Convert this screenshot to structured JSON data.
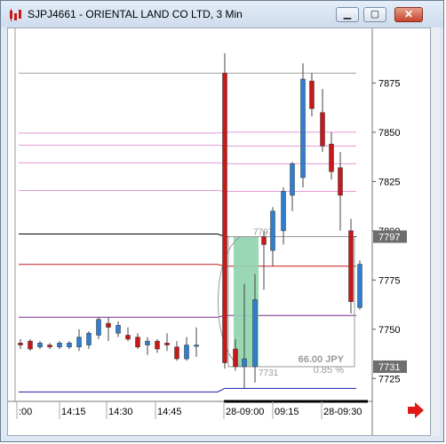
{
  "window": {
    "title": "SJPJ4661 - ORIENTAL LAND CO LTD, 3 Min",
    "min_glyph": "▁",
    "max_glyph": "▢",
    "close_glyph": "✕"
  },
  "chart_data": {
    "type": "candlestick",
    "instrument": "SJPJ4661",
    "x_labels": [
      ":00",
      "14:15",
      "14:30",
      "14:45",
      "28-09:00",
      "09:15",
      "28-09:30"
    ],
    "y_ticks": [
      7875,
      7850,
      7825,
      7800,
      7775,
      7750,
      7725
    ],
    "ylim": [
      7717,
      7900
    ],
    "price_labels": [
      {
        "value": 7797,
        "text": "7797"
      },
      {
        "value": 7731,
        "text": "7731"
      }
    ],
    "grid": false,
    "candles": [
      {
        "o": 7743,
        "h": 7745,
        "l": 7740,
        "c": 7742
      },
      {
        "o": 7744,
        "h": 7745,
        "l": 7739,
        "c": 7740
      },
      {
        "o": 7741,
        "h": 7744,
        "l": 7740,
        "c": 7743
      },
      {
        "o": 7742,
        "h": 7743,
        "l": 7740,
        "c": 7741
      },
      {
        "o": 7741,
        "h": 7744,
        "l": 7740,
        "c": 7743
      },
      {
        "o": 7741,
        "h": 7744,
        "l": 7740,
        "c": 7743
      },
      {
        "o": 7741,
        "h": 7750,
        "l": 7739,
        "c": 7746
      },
      {
        "o": 7742,
        "h": 7749,
        "l": 7740,
        "c": 7748
      },
      {
        "o": 7747,
        "h": 7756,
        "l": 7745,
        "c": 7755
      },
      {
        "o": 7753,
        "h": 7756,
        "l": 7744,
        "c": 7751
      },
      {
        "o": 7748,
        "h": 7754,
        "l": 7746,
        "c": 7752
      },
      {
        "o": 7747,
        "h": 7751,
        "l": 7744,
        "c": 7745
      },
      {
        "o": 7746,
        "h": 7748,
        "l": 7740,
        "c": 7741
      },
      {
        "o": 7742,
        "h": 7746,
        "l": 7737,
        "c": 7744
      },
      {
        "o": 7744,
        "h": 7745,
        "l": 7738,
        "c": 7740
      },
      {
        "o": 7743,
        "h": 7748,
        "l": 7739,
        "c": 7742
      },
      {
        "o": 7741,
        "h": 7744,
        "l": 7734,
        "c": 7735
      },
      {
        "o": 7735,
        "h": 7746,
        "l": 7734,
        "c": 7742
      },
      {
        "o": 7742,
        "h": 7751,
        "l": 7736,
        "c": 7742
      },
      {
        "o": 7880,
        "h": 7890,
        "l": 7730,
        "c": 7733
      },
      {
        "o": 7740,
        "h": 7745,
        "l": 7729,
        "c": 7731
      },
      {
        "o": 7731,
        "h": 7773,
        "l": 7720,
        "c": 7735
      },
      {
        "o": 7731,
        "h": 7778,
        "l": 7723,
        "c": 7765
      },
      {
        "o": 7797,
        "h": 7800,
        "l": 7770,
        "c": 7793
      },
      {
        "o": 7790,
        "h": 7812,
        "l": 7782,
        "c": 7810
      },
      {
        "o": 7800,
        "h": 7822,
        "l": 7793,
        "c": 7820
      },
      {
        "o": 7818,
        "h": 7835,
        "l": 7810,
        "c": 7834
      },
      {
        "o": 7827,
        "h": 7885,
        "l": 7822,
        "c": 7877
      },
      {
        "o": 7876,
        "h": 7880,
        "l": 7858,
        "c": 7862
      },
      {
        "o": 7860,
        "h": 7872,
        "l": 7840,
        "c": 7843
      },
      {
        "o": 7844,
        "h": 7850,
        "l": 7826,
        "c": 7830
      },
      {
        "o": 7832,
        "h": 7840,
        "l": 7800,
        "c": 7818
      },
      {
        "o": 7800,
        "h": 7806,
        "l": 7758,
        "c": 7764
      },
      {
        "o": 7761,
        "h": 7785,
        "l": 7760,
        "c": 7783
      }
    ],
    "colors": {
      "up": "#2e7fd0",
      "down": "#c81818",
      "wick": "#444444"
    },
    "levels": [
      {
        "name": "gray",
        "value": 7880,
        "color": "#a0a0a0",
        "from": "full"
      },
      {
        "name": "pink1",
        "value": 7850,
        "color": "#e29ad6",
        "from": "full",
        "shift": -1
      },
      {
        "name": "pink2",
        "value": 7843,
        "color": "#e29ad6",
        "from": "full",
        "shift": 1
      },
      {
        "name": "pink3",
        "value": 7834,
        "color": "#e29ad6",
        "from": "full",
        "shift": 1
      },
      {
        "name": "pink4",
        "value": 7820,
        "color": "#e29ad6",
        "from": "full",
        "shift": 1
      },
      {
        "name": "black",
        "value": 7797,
        "color": "#000000",
        "from": "full",
        "shift": 3
      },
      {
        "name": "red",
        "value": 7782,
        "color": "#c81818",
        "from": "full",
        "shift": 2
      },
      {
        "name": "purple",
        "value": 7757,
        "color": "#7a2a8a",
        "from": "full",
        "shift": -2
      },
      {
        "name": "blue",
        "value": 7720,
        "color": "#1c1ca8",
        "from": "full",
        "shift": -4
      }
    ],
    "measurement": {
      "top_value_text": "7797",
      "bottom_value_text": "7731",
      "change_text": "66.00 JPY",
      "percent_text": "0.85 %"
    }
  }
}
